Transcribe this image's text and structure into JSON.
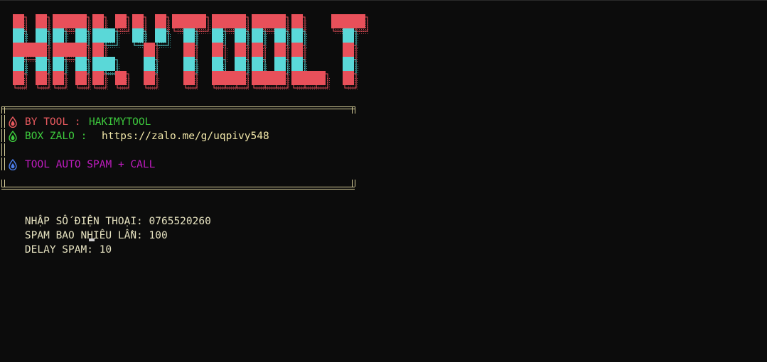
{
  "banner": {
    "logo_text": "HAKYTOOLT",
    "colors": {
      "red": "#e8505a",
      "cyan": "#5ad8d8",
      "red_dots": "#c04048",
      "cyan_dots": "#40a8a8"
    }
  },
  "info_box": {
    "by_tool_label": "BY TOOL : ",
    "by_tool_value": "HAKIMYTOOL",
    "box_zalo_label": "BOX ZALO :",
    "box_zalo_value": "https://zalo.me/g/uqpivy548",
    "tool_desc": "TOOL AUTO SPAM + CALL",
    "icons": [
      "red-drop-icon",
      "green-drop-icon",
      "blue-drop-icon"
    ]
  },
  "prompts": [
    {
      "label": "NHẬP SỐ ĐIỆN THOẠI: ",
      "value": "0765520260"
    },
    {
      "label": "SPAM BAO NHIÊU LẦN: ",
      "value": "100"
    },
    {
      "label": "DELAY SPAM: ",
      "value": "10"
    }
  ]
}
